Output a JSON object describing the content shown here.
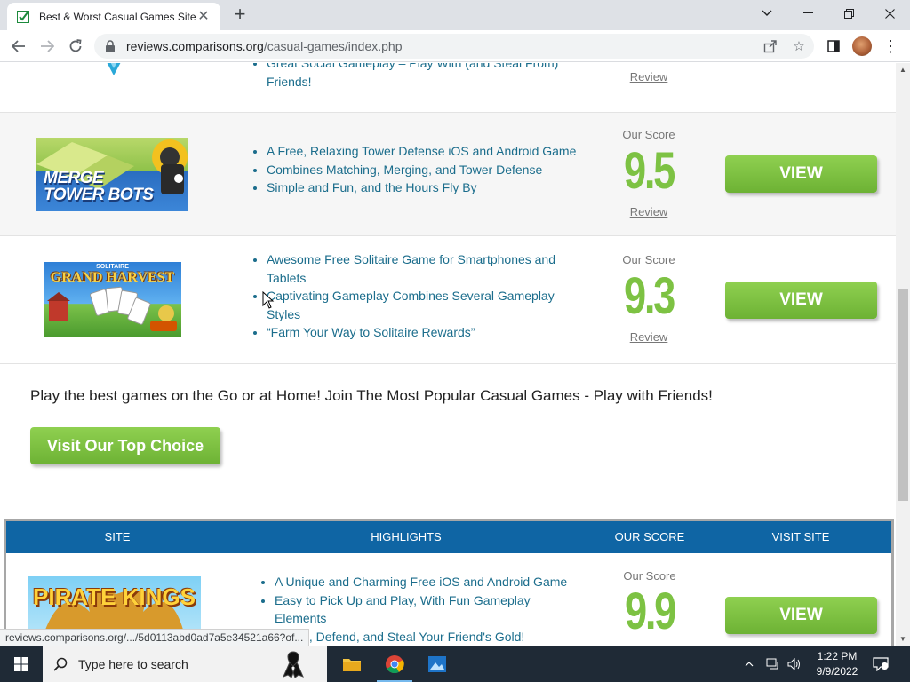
{
  "browser": {
    "tab_title": "Best & Worst Casual Games Sites",
    "url_domain": "reviews.comparisons.org",
    "url_path": "/casual-games/index.php"
  },
  "colors": {
    "score_green": "#7dc243",
    "button_green": "#7cc141",
    "link_blue": "#1b6d8c",
    "table_header_blue": "#0f65a4"
  },
  "partial_row": {
    "features": [
      "Great Social Gameplay – Play With (and Steal From) Friends!"
    ],
    "review_label": "Review"
  },
  "rows": [
    {
      "logo_text": [
        "MERGE",
        "TOWER BOTS"
      ],
      "features": [
        "A Free, Relaxing Tower Defense iOS and Android Game",
        "Combines Matching, Merging, and Tower Defense",
        "Simple and Fun, and the Hours Fly By"
      ],
      "score_label": "Our Score",
      "score": "9.5",
      "review_label": "Review",
      "button_label": "VIEW"
    },
    {
      "logo_text": [
        "SOLITAIRE",
        "GRAND HARVEST"
      ],
      "features": [
        "Awesome Free Solitaire Game for Smartphones and Tablets",
        "Captivating Gameplay Combines Several Gameplay Styles",
        "“Farm Your Way to Solitaire Rewards”"
      ],
      "score_label": "Our Score",
      "score": "9.3",
      "review_label": "Review",
      "button_label": "VIEW"
    }
  ],
  "promo": {
    "text": "Play the best games on the Go or at Home! Join The Most Popular Casual Games - Play with Friends!",
    "button_label": "Visit Our Top Choice"
  },
  "table": {
    "headers": [
      "SITE",
      "HIGHLIGHTS",
      "OUR SCORE",
      "VISIT SITE"
    ],
    "first_row": {
      "logo_text": "PIRATE KINGS",
      "features": [
        "A Unique and Charming Free iOS and Android Game",
        "Easy to Pick Up and Play, With Fun Gameplay Elements",
        "Attack, Defend, and Steal Your Friend's Gold!"
      ],
      "score_label": "Our Score",
      "score": "9.9",
      "button_label": "VIEW"
    }
  },
  "status_url": "reviews.comparisons.org/.../5d0113abd0ad7a5e34521a66?of...",
  "taskbar": {
    "search_placeholder": "Type here to search",
    "time": "1:22 PM",
    "date": "9/9/2022"
  }
}
